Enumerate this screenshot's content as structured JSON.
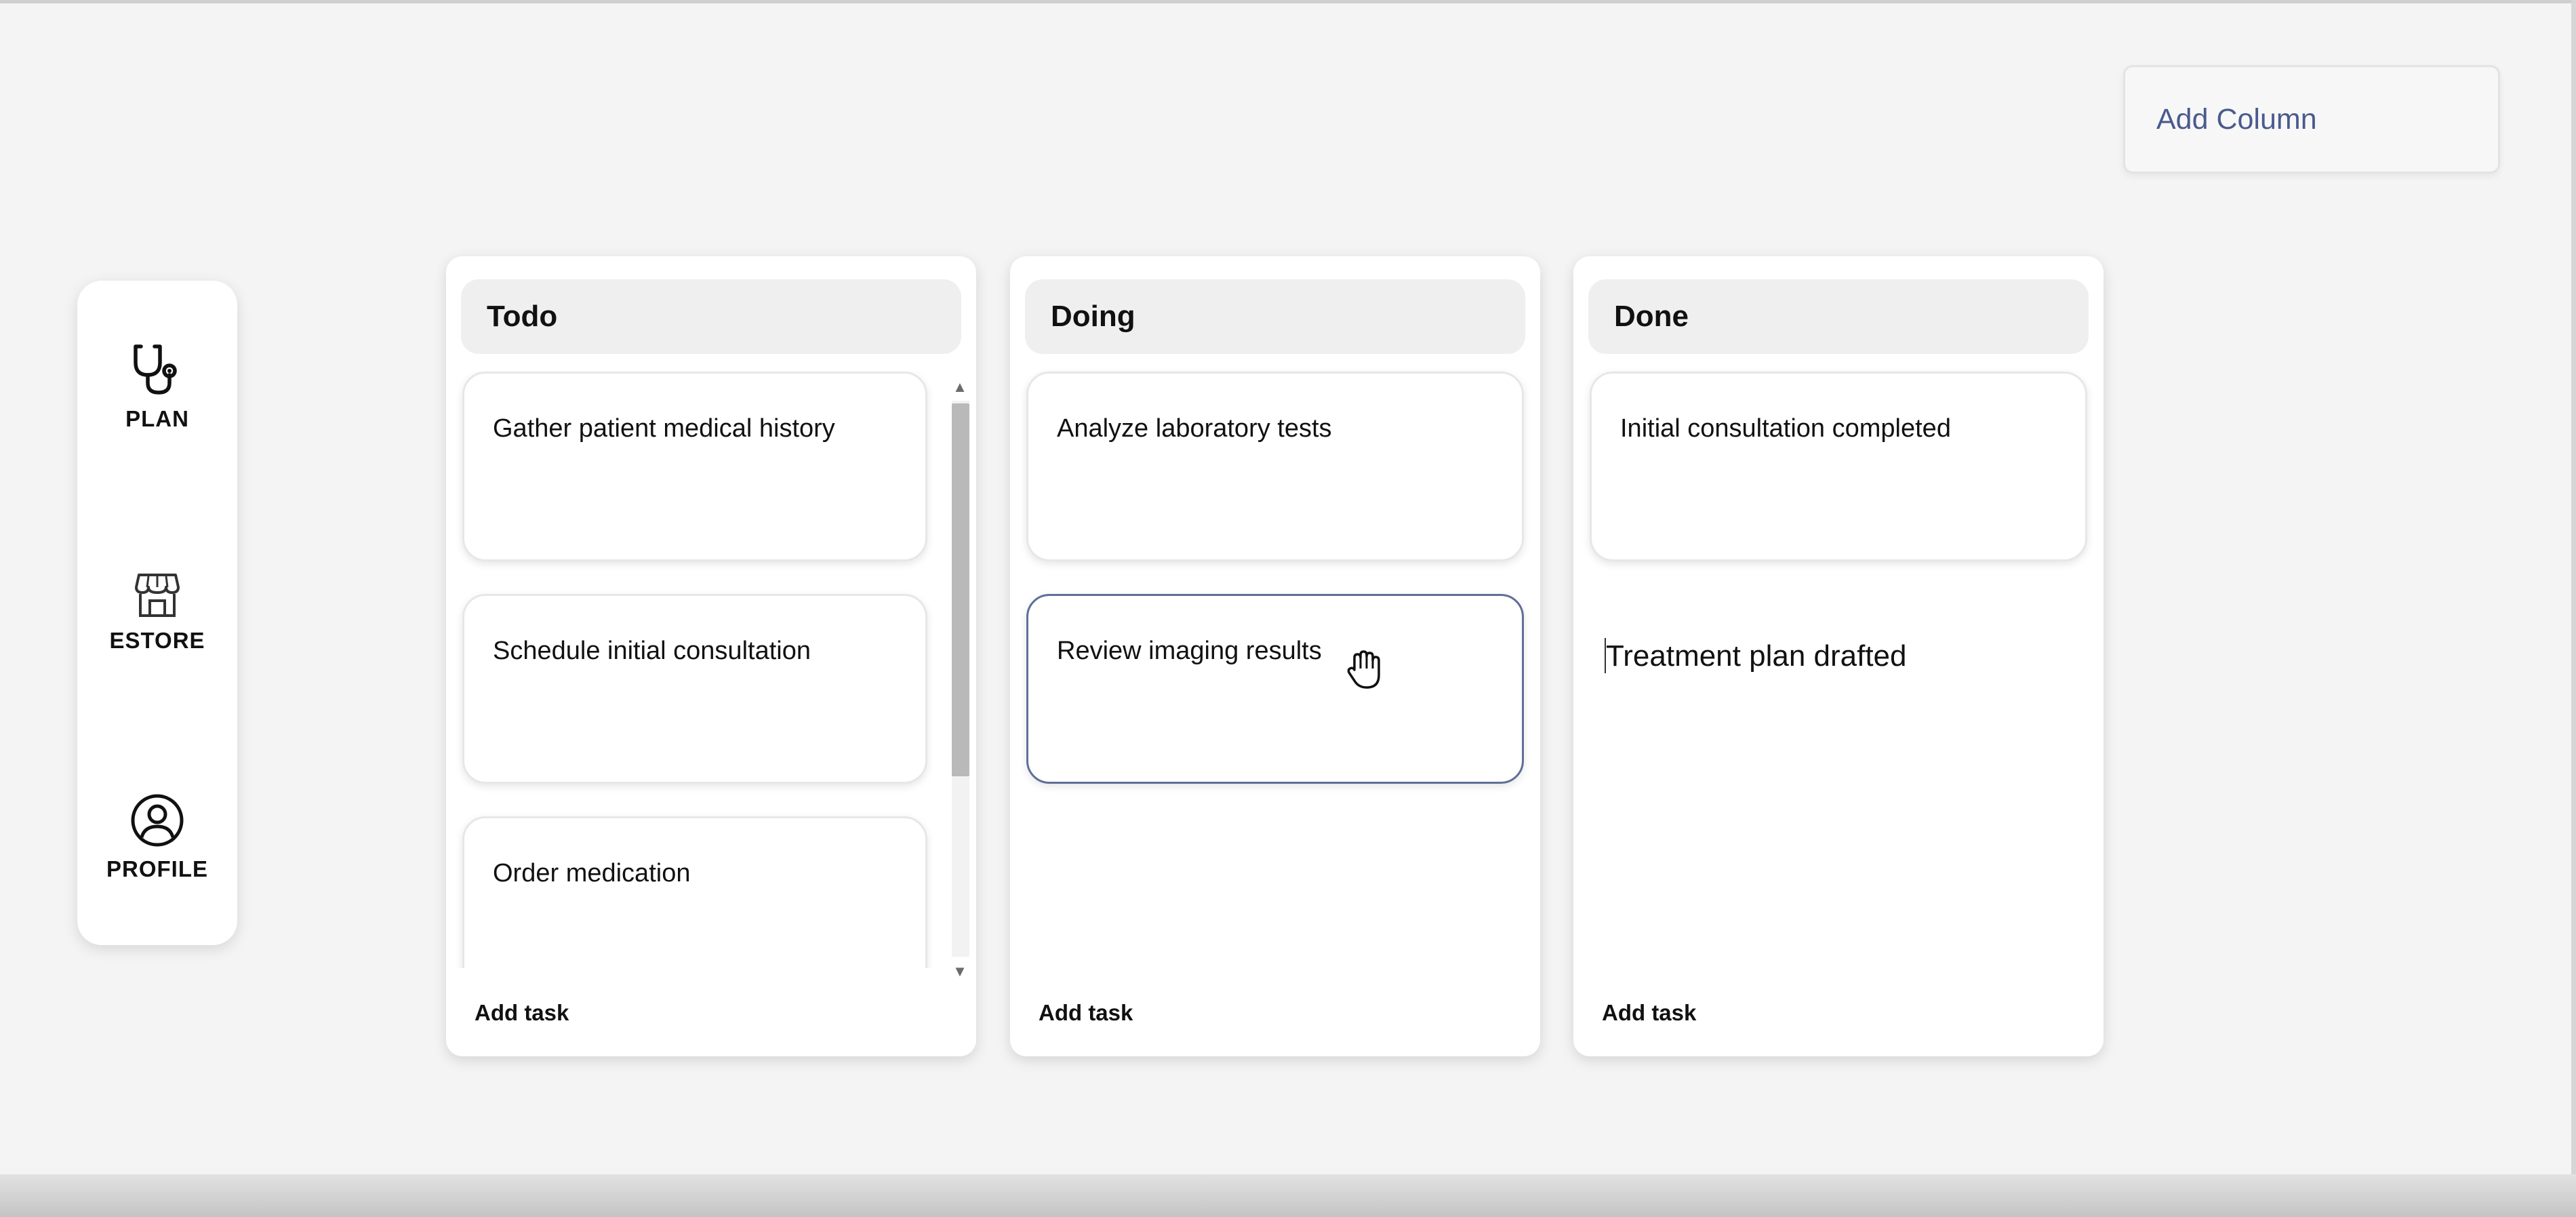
{
  "toolbar": {
    "add_column_label": "Add Column"
  },
  "sidebar": {
    "items": [
      {
        "label": "PLAN",
        "icon": "stethoscope-icon"
      },
      {
        "label": "ESTORE",
        "icon": "store-icon"
      },
      {
        "label": "PROFILE",
        "icon": "user-circle-icon"
      }
    ]
  },
  "board": {
    "columns": [
      {
        "title": "Todo",
        "cards": [
          "Gather patient medical history",
          "Schedule initial consultation",
          "Order medication"
        ],
        "add_task_label": "Add task"
      },
      {
        "title": "Doing",
        "cards": [
          "Analyze laboratory tests",
          "Review imaging results"
        ],
        "add_task_label": "Add task"
      },
      {
        "title": "Done",
        "cards": [
          "Initial consultation completed"
        ],
        "editing_text": "Treatment plan drafted",
        "add_task_label": "Add task"
      }
    ]
  },
  "colors": {
    "background": "#f4f4f4",
    "panel": "#ffffff",
    "header_fill": "#efefef",
    "selected_border": "#5f6f9a",
    "accent_text": "#4a5a8f"
  }
}
